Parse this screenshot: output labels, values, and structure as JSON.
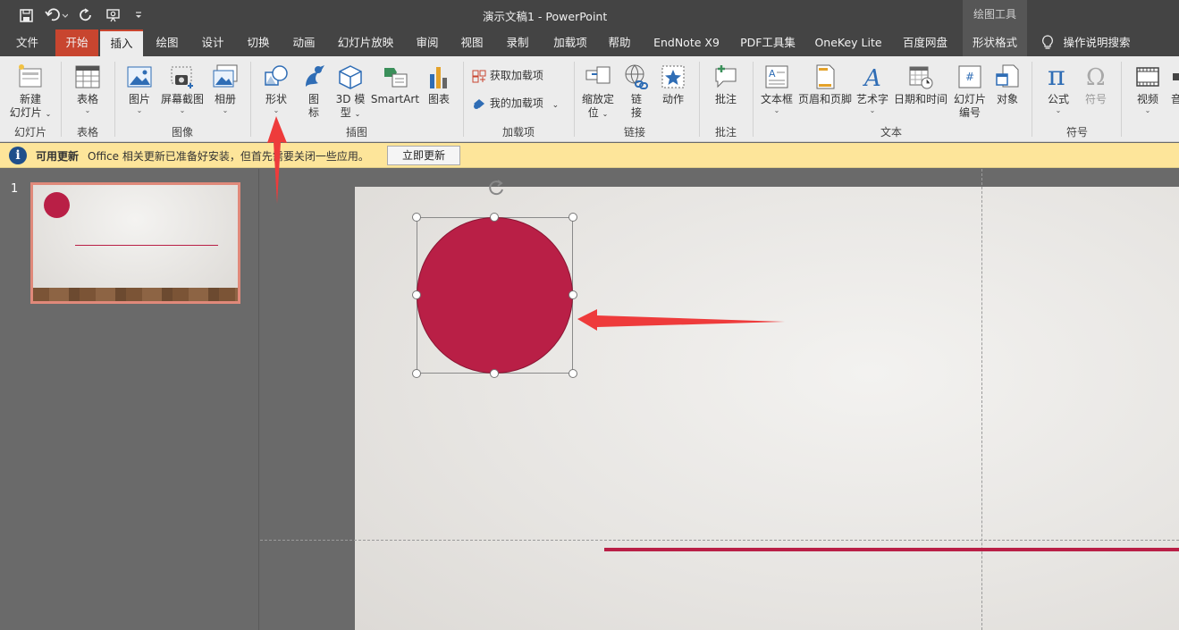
{
  "titlebar": {
    "title": "演示文稿1  -  PowerPoint",
    "context_label": "绘图工具",
    "quick_access": [
      "save-icon",
      "undo-icon",
      "redo-icon",
      "present-icon",
      "customize-icon"
    ]
  },
  "tabs": [
    "文件",
    "开始",
    "插入",
    "绘图",
    "设计",
    "切换",
    "动画",
    "幻灯片放映",
    "审阅",
    "视图",
    "录制",
    "加载项",
    "帮助",
    "EndNote X9",
    "PDF工具集",
    "OneKey Lite",
    "百度网盘",
    "形状格式",
    "操作说明搜索"
  ],
  "ribbon": {
    "slides": {
      "new_slide_line1": "新建",
      "new_slide_line2": "幻灯片",
      "group": "幻灯片"
    },
    "tables": {
      "table": "表格",
      "group": "表格"
    },
    "images": {
      "pictures": "图片",
      "screenshot": "屏幕截图",
      "album": "相册",
      "group": "图像"
    },
    "illustrations": {
      "shapes": "形状",
      "icons_line1": "图",
      "icons_line2": "标",
      "model_line1": "3D 模",
      "model_line2": "型",
      "smartart": "SmartArt",
      "chart": "图表",
      "group": "插图"
    },
    "addins": {
      "get": "获取加载项",
      "mine": "我的加载项",
      "group": "加载项"
    },
    "links": {
      "zoom_line1": "缩放定",
      "zoom_line2": "位",
      "link_line1": "链",
      "link_line2": "接",
      "action": "动作",
      "group": "链接"
    },
    "comments": {
      "comment": "批注",
      "group": "批注"
    },
    "text": {
      "textbox": "文本框",
      "header_footer": "页眉和页脚",
      "wordart": "艺术字",
      "datetime": "日期和时间",
      "slide_num_line1": "幻灯片",
      "slide_num_line2": "编号",
      "object": "对象",
      "group": "文本"
    },
    "symbols": {
      "equation": "公式",
      "symbol": "符号",
      "group": "符号"
    },
    "media": {
      "video": "视频",
      "audio": "音"
    }
  },
  "infobar": {
    "title": "可用更新",
    "message": "Office 相关更新已准备好安装，但首先需要关闭一些应用。",
    "button": "立即更新"
  },
  "thumbnails": {
    "slide_number": "1"
  },
  "colors": {
    "accent": "#c8452f",
    "shape_fill": "#b91f46",
    "annotation_arrow": "#ee3b3b"
  }
}
